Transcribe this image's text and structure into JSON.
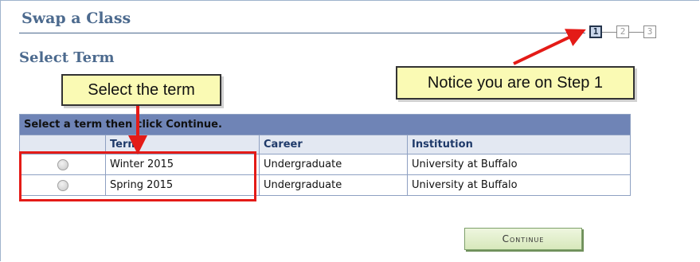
{
  "page": {
    "title": "Swap a Class",
    "subtitle": "Select Term"
  },
  "steps": [
    "1",
    "2",
    "3"
  ],
  "active_step": "1",
  "callouts": {
    "term": "Select the term",
    "step": "Notice you are on Step 1"
  },
  "grid": {
    "caption": "Select a term then click Continue.",
    "columns": [
      "Term",
      "Career",
      "Institution"
    ],
    "rows": [
      {
        "term": "Winter 2015",
        "career": "Undergraduate",
        "institution": "University at Buffalo"
      },
      {
        "term": "Spring 2015",
        "career": "Undergraduate",
        "institution": "University at Buffalo"
      }
    ]
  },
  "buttons": {
    "continue": "Continue"
  },
  "colors": {
    "accent": "#4c6a8e",
    "grid_header": "#6f84b6",
    "annotation": "#e41b17",
    "callout": "#fafab4"
  }
}
